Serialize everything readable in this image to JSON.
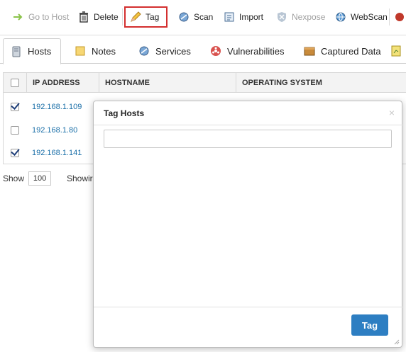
{
  "toolbar": {
    "go_to_host": "Go to Host",
    "delete": "Delete",
    "tag": "Tag",
    "scan": "Scan",
    "import": "Import",
    "nexpose": "Nexpose",
    "webscan": "WebScan"
  },
  "tabs": [
    {
      "label": "Hosts",
      "icon": "hosts-icon"
    },
    {
      "label": "Notes",
      "icon": "notes-icon"
    },
    {
      "label": "Services",
      "icon": "services-icon"
    },
    {
      "label": "Vulnerabilities",
      "icon": "vulnerabilities-icon"
    },
    {
      "label": "Captured Data",
      "icon": "captured-data-icon"
    }
  ],
  "table": {
    "columns": [
      "IP ADDRESS",
      "HOSTNAME",
      "OPERATING SYSTEM"
    ],
    "rows": [
      {
        "ip": "192.168.1.109",
        "checked": true
      },
      {
        "ip": "192.168.1.80",
        "checked": false
      },
      {
        "ip": "192.168.1.141",
        "checked": true
      }
    ]
  },
  "pager": {
    "show_label": "Show",
    "page_size": "100",
    "showing_label": "Showir"
  },
  "modal": {
    "title": "Tag Hosts",
    "close": "×",
    "input_value": "",
    "submit": "Tag"
  },
  "colors": {
    "accent": "#2d7ec2",
    "link": "#1a6fa8",
    "highlight": "#d32f2f"
  }
}
